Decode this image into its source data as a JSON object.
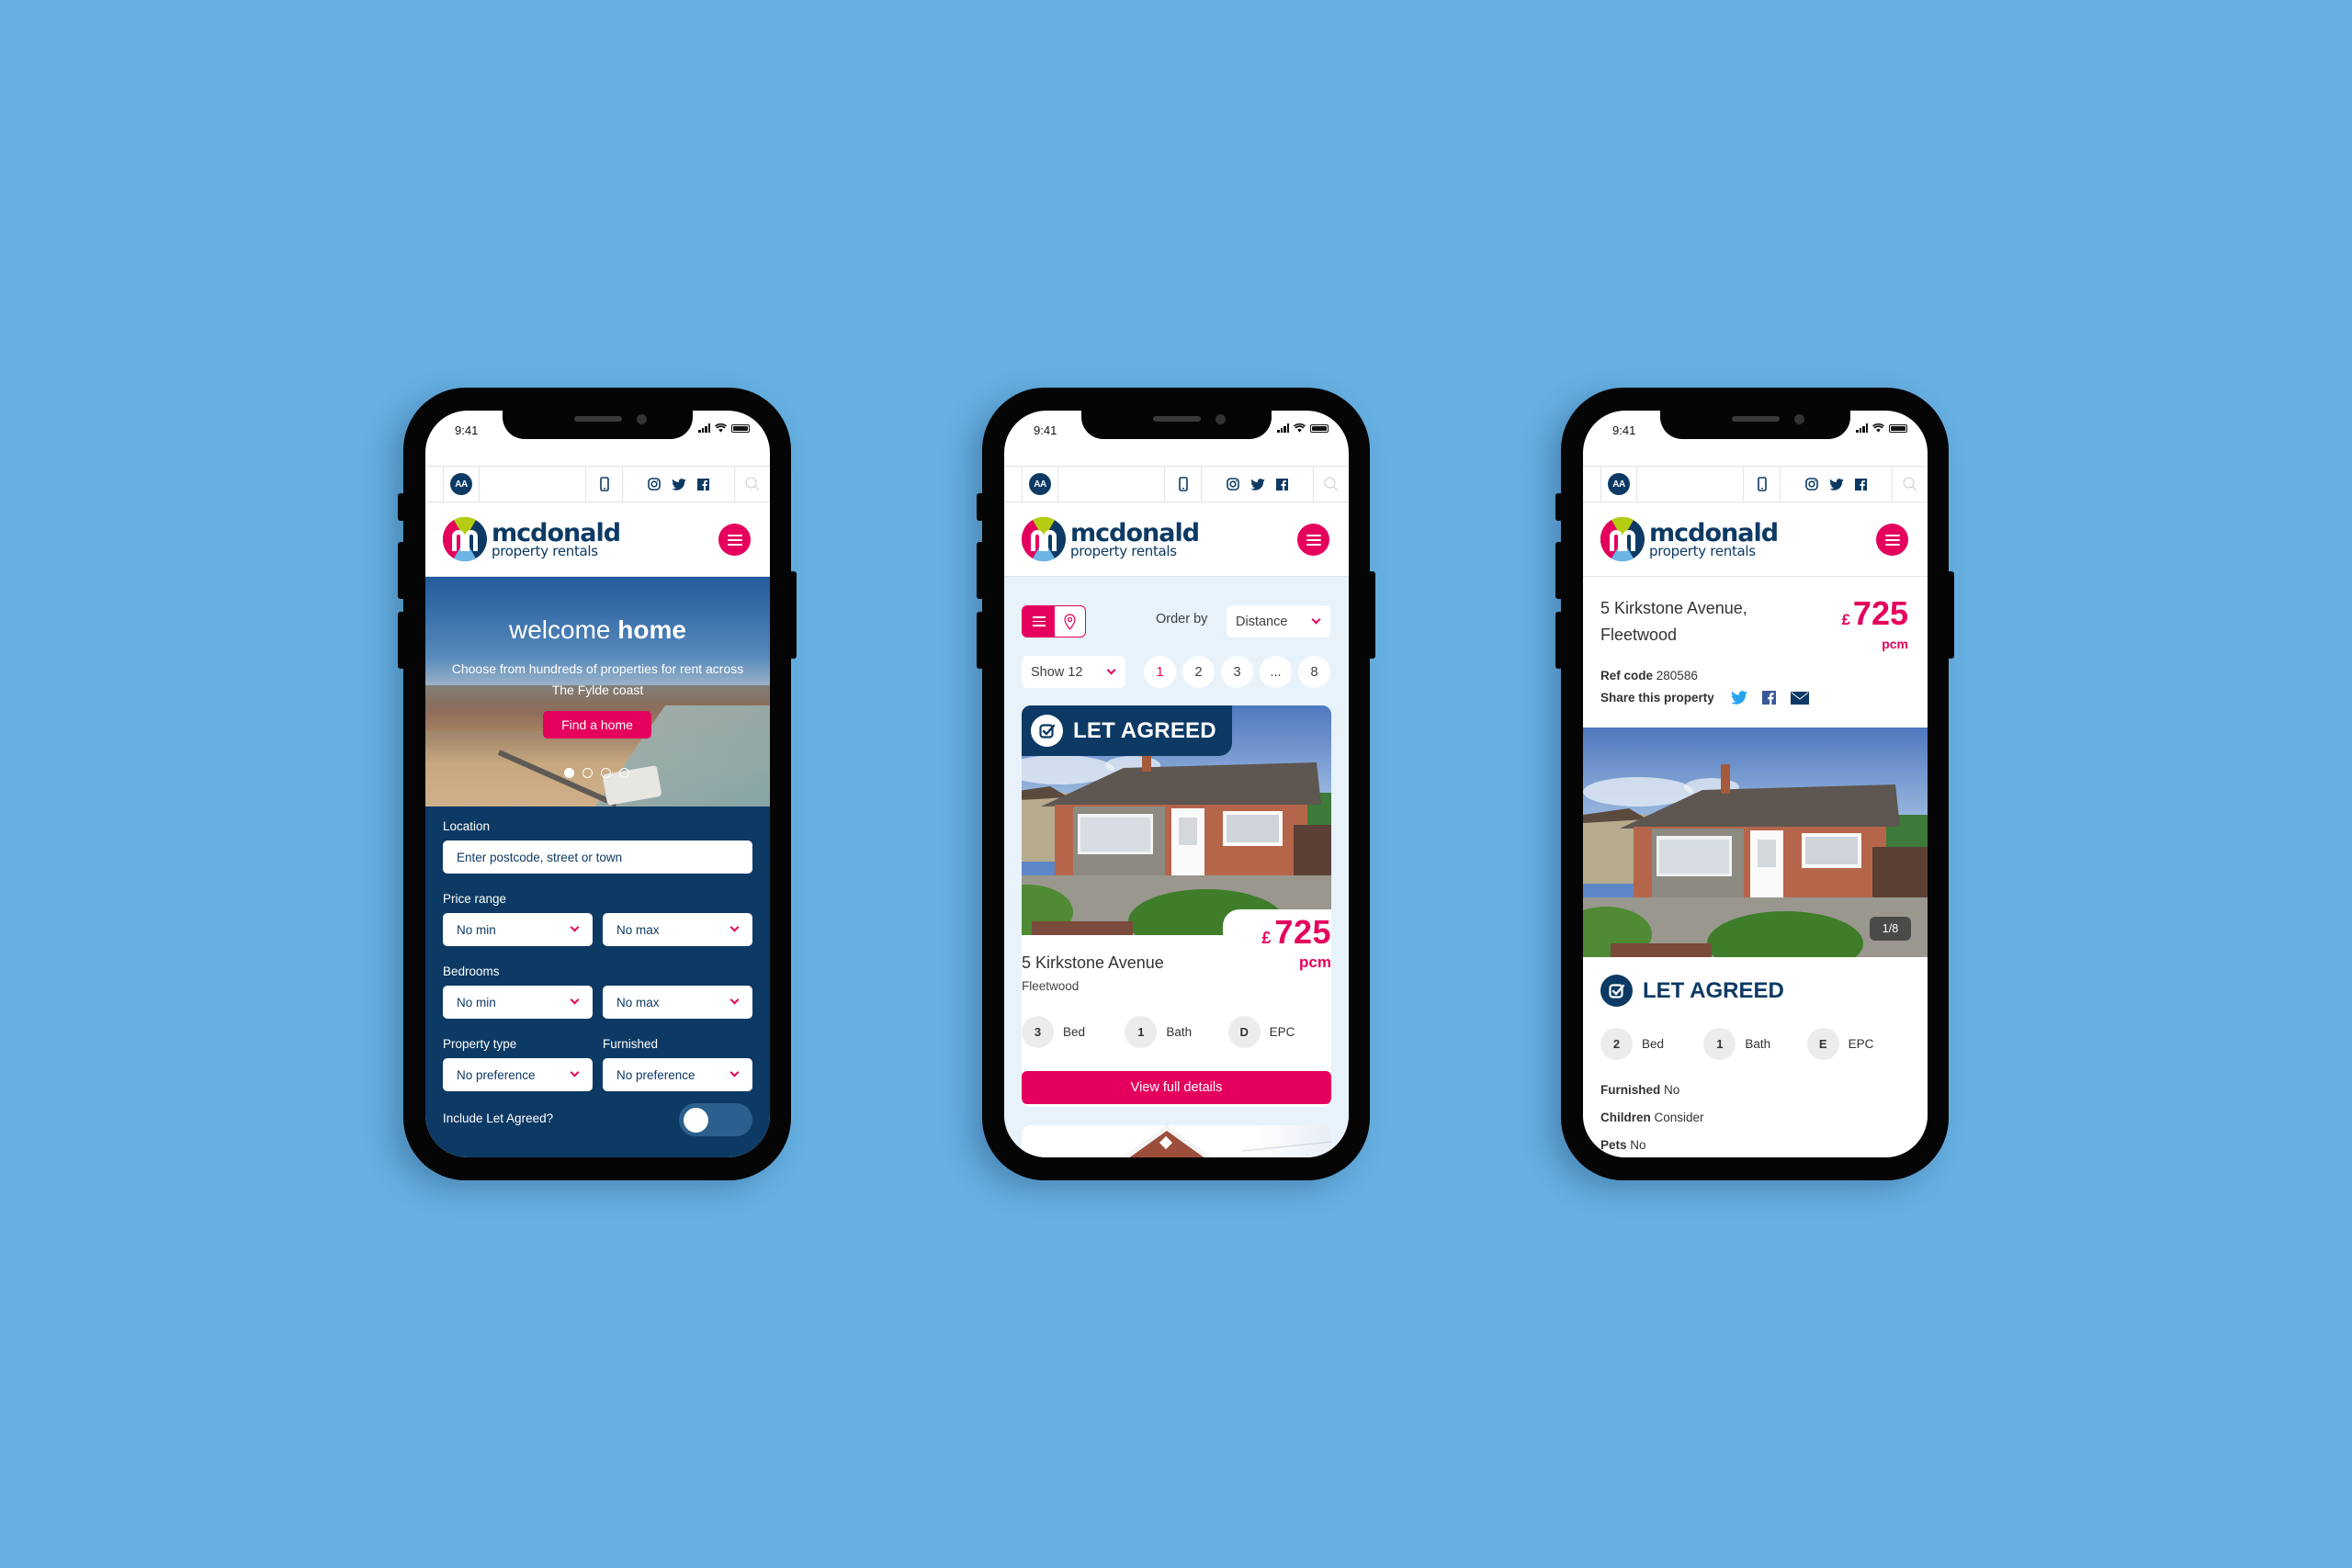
{
  "background_color": "#66b0e2",
  "colors": {
    "brand_navy": "#0d3a64",
    "brand_pink": "#e4005c",
    "list_bg": "#e7f2fa"
  },
  "common": {
    "status_time": "9:41",
    "aa_label": "AA",
    "logo_main": "mcdonald",
    "logo_sub": "property rentals",
    "icons": [
      "text-size-icon",
      "phone-icon",
      "instagram-icon",
      "twitter-icon",
      "facebook-icon",
      "search-icon",
      "hamburger-menu-icon"
    ]
  },
  "home": {
    "hero_title_light": "welcome ",
    "hero_title_bold": "home",
    "hero_subtitle": "Choose from hundreds of properties for rent across The Fylde coast",
    "hero_button": "Find a home",
    "carousel": {
      "slides": 4,
      "active": 1
    },
    "search": {
      "location_label": "Location",
      "location_placeholder": "Enter postcode, street or town",
      "price_label": "Price range",
      "price_min": "No min",
      "price_max": "No max",
      "bedrooms_label": "Bedrooms",
      "bed_min": "No min",
      "bed_max": "No max",
      "property_type_label": "Property type",
      "property_type_value": "No preference",
      "furnished_label": "Furnished",
      "furnished_value": "No preference",
      "include_let_agreed_label": "Include Let Agreed?",
      "include_let_agreed": false
    }
  },
  "listing": {
    "view_mode": "list",
    "order_by_label": "Order by",
    "order_by_value": "Distance",
    "show_value": "Show 12",
    "pages": [
      "1",
      "2",
      "3",
      "...",
      "8"
    ],
    "current_page": "1",
    "card": {
      "status": "LET AGREED",
      "currency": "£",
      "price": "725",
      "period": "pcm",
      "title": "5 Kirkstone Avenue",
      "town": "Fleetwood",
      "stats": [
        {
          "value": "3",
          "label": "Bed"
        },
        {
          "value": "1",
          "label": "Bath"
        },
        {
          "value": "D",
          "label": "EPC"
        }
      ],
      "button": "View full details"
    }
  },
  "detail": {
    "title": "5 Kirkstone Avenue, Fleetwood",
    "currency": "£",
    "price": "725",
    "period": "pcm",
    "ref_label": "Ref code",
    "ref_value": "280586",
    "share_label": "Share this property",
    "photo_counter": "1/8",
    "status": "LET AGREED",
    "stats": [
      {
        "value": "2",
        "label": "Bed"
      },
      {
        "value": "1",
        "label": "Bath"
      },
      {
        "value": "E",
        "label": "EPC"
      }
    ],
    "features": [
      {
        "label": "Furnished",
        "value": "No"
      },
      {
        "label": "Children",
        "value": "Consider"
      },
      {
        "label": "Pets",
        "value": "No"
      }
    ]
  }
}
